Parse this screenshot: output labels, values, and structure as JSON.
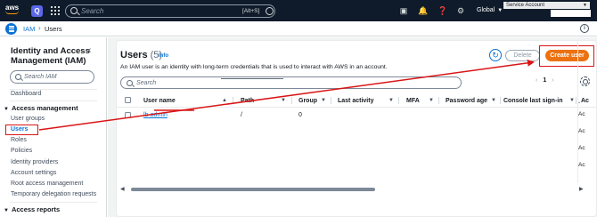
{
  "topbar": {
    "logo": "aws",
    "q_icon": "Q",
    "search_placeholder": "Search",
    "search_shortcut": "[Alt+S]",
    "region": "Global",
    "account_label": "Service Account"
  },
  "subbar": {
    "breadcrumb": [
      "IAM",
      "Users"
    ]
  },
  "sidebar": {
    "title": "Identity and Access Management (IAM)",
    "search_placeholder": "Search IAM",
    "dashboard": "Dashboard",
    "section_access_management": "Access management",
    "items": [
      "User groups",
      "Users",
      "Roles",
      "Policies",
      "Identity providers",
      "Account settings",
      "Root access management",
      "Temporary delegation requests"
    ],
    "section_access_reports": "Access reports"
  },
  "main": {
    "title": "Users",
    "count": "(5)",
    "info": "Info",
    "description": "An IAM user is an identity with long-term credentials that is used to interact with AWS in an account.",
    "delete_label": "Delete",
    "create_label": "Create user",
    "search_placeholder": "Search",
    "page": "1",
    "columns": [
      "User name",
      "Path",
      "Group",
      "Last activity",
      "MFA",
      "Password age",
      "Console last sign-in",
      "Ac"
    ],
    "row": {
      "user_name": "lb-admin",
      "path": "/",
      "groups": "0",
      "access_col": "-"
    },
    "access_col_values": [
      "-",
      "Ac",
      "Ac",
      "Ac",
      "Ac"
    ]
  },
  "colors": {
    "topbar_bg": "#0f1b2a",
    "link": "#0972d3",
    "primary_button": "#ec7211",
    "annotation": "#d91515"
  }
}
